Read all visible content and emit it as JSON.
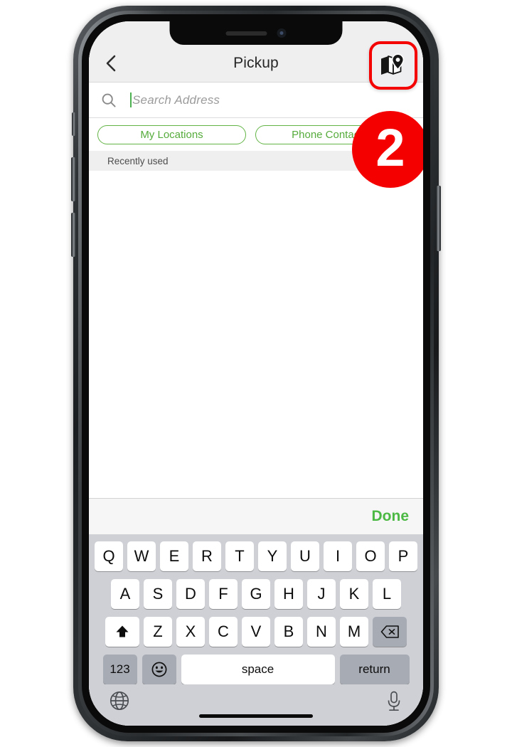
{
  "device": {
    "type": "smartphone",
    "notch_elements": [
      "speaker-grille",
      "front-camera"
    ],
    "side_buttons": [
      "mute-switch",
      "volume-up",
      "volume-down",
      "power"
    ]
  },
  "annotation": {
    "step_badge": "2",
    "badge_color": "#f50000",
    "highlight_target": "map-view-button",
    "highlight_color": "#f50000"
  },
  "navbar": {
    "back_icon": "chevron-left-icon",
    "title": "Pickup",
    "map_button_icon": "map-pin-icon"
  },
  "search": {
    "icon": "search-icon",
    "value": "",
    "placeholder": "Search Address",
    "caret_color": "#4caf50"
  },
  "filters": {
    "pills": [
      {
        "label": "My Locations"
      },
      {
        "label": "Phone Contacts"
      }
    ],
    "accent_color": "#62b445"
  },
  "list": {
    "section_header": "Recently used",
    "items": []
  },
  "accessory_bar": {
    "done_label": "Done",
    "done_color": "#4cb944"
  },
  "keyboard": {
    "row1": [
      "Q",
      "W",
      "E",
      "R",
      "T",
      "Y",
      "U",
      "I",
      "O",
      "P"
    ],
    "row2": [
      "A",
      "S",
      "D",
      "F",
      "G",
      "H",
      "J",
      "K",
      "L"
    ],
    "row3_letters": [
      "Z",
      "X",
      "C",
      "V",
      "B",
      "N",
      "M"
    ],
    "shift_icon": "shift-arrow-icon",
    "backspace_icon": "backspace-icon",
    "numbers_label": "123",
    "emoji_icon": "emoji-smiley-icon",
    "space_label": "space",
    "return_label": "return",
    "globe_icon": "globe-icon",
    "mic_icon": "microphone-icon"
  }
}
